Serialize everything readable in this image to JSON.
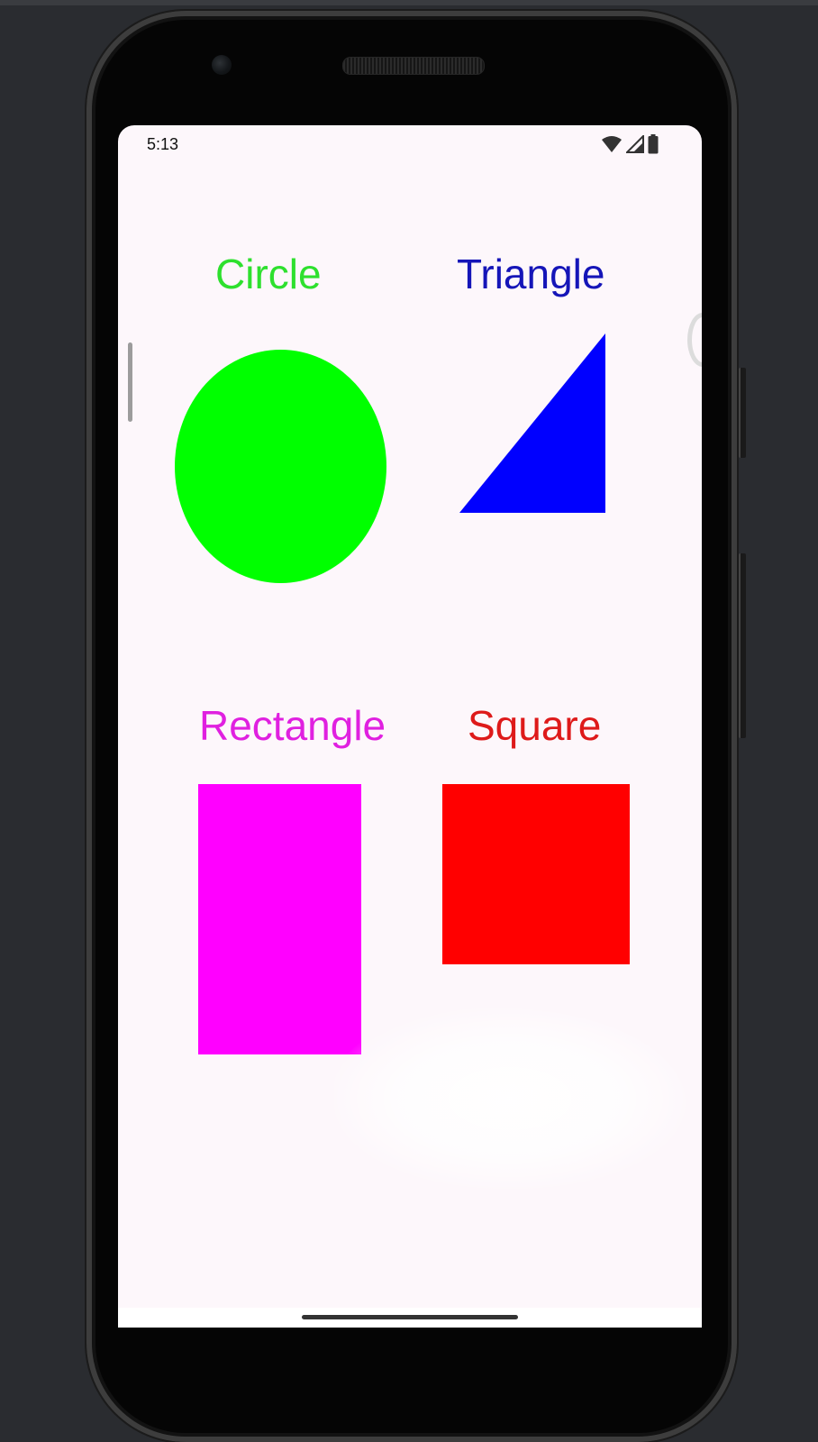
{
  "status_bar": {
    "time": "5:13",
    "icons": [
      "wifi-icon",
      "signal-icon",
      "battery-icon"
    ]
  },
  "shapes": {
    "circle": {
      "label": "Circle",
      "label_color": "#2ee02e",
      "fill": "#00ff00"
    },
    "triangle": {
      "label": "Triangle",
      "label_color": "#1515b8",
      "fill": "#0000ff"
    },
    "rectangle": {
      "label": "Rectangle",
      "label_color": "#e020e0",
      "fill": "#ff00ff"
    },
    "square": {
      "label": "Square",
      "label_color": "#de1a1a",
      "fill": "#ff0000"
    }
  },
  "colors": {
    "screen_background": "#fdf7fb",
    "device_background": "#2a2c30"
  }
}
